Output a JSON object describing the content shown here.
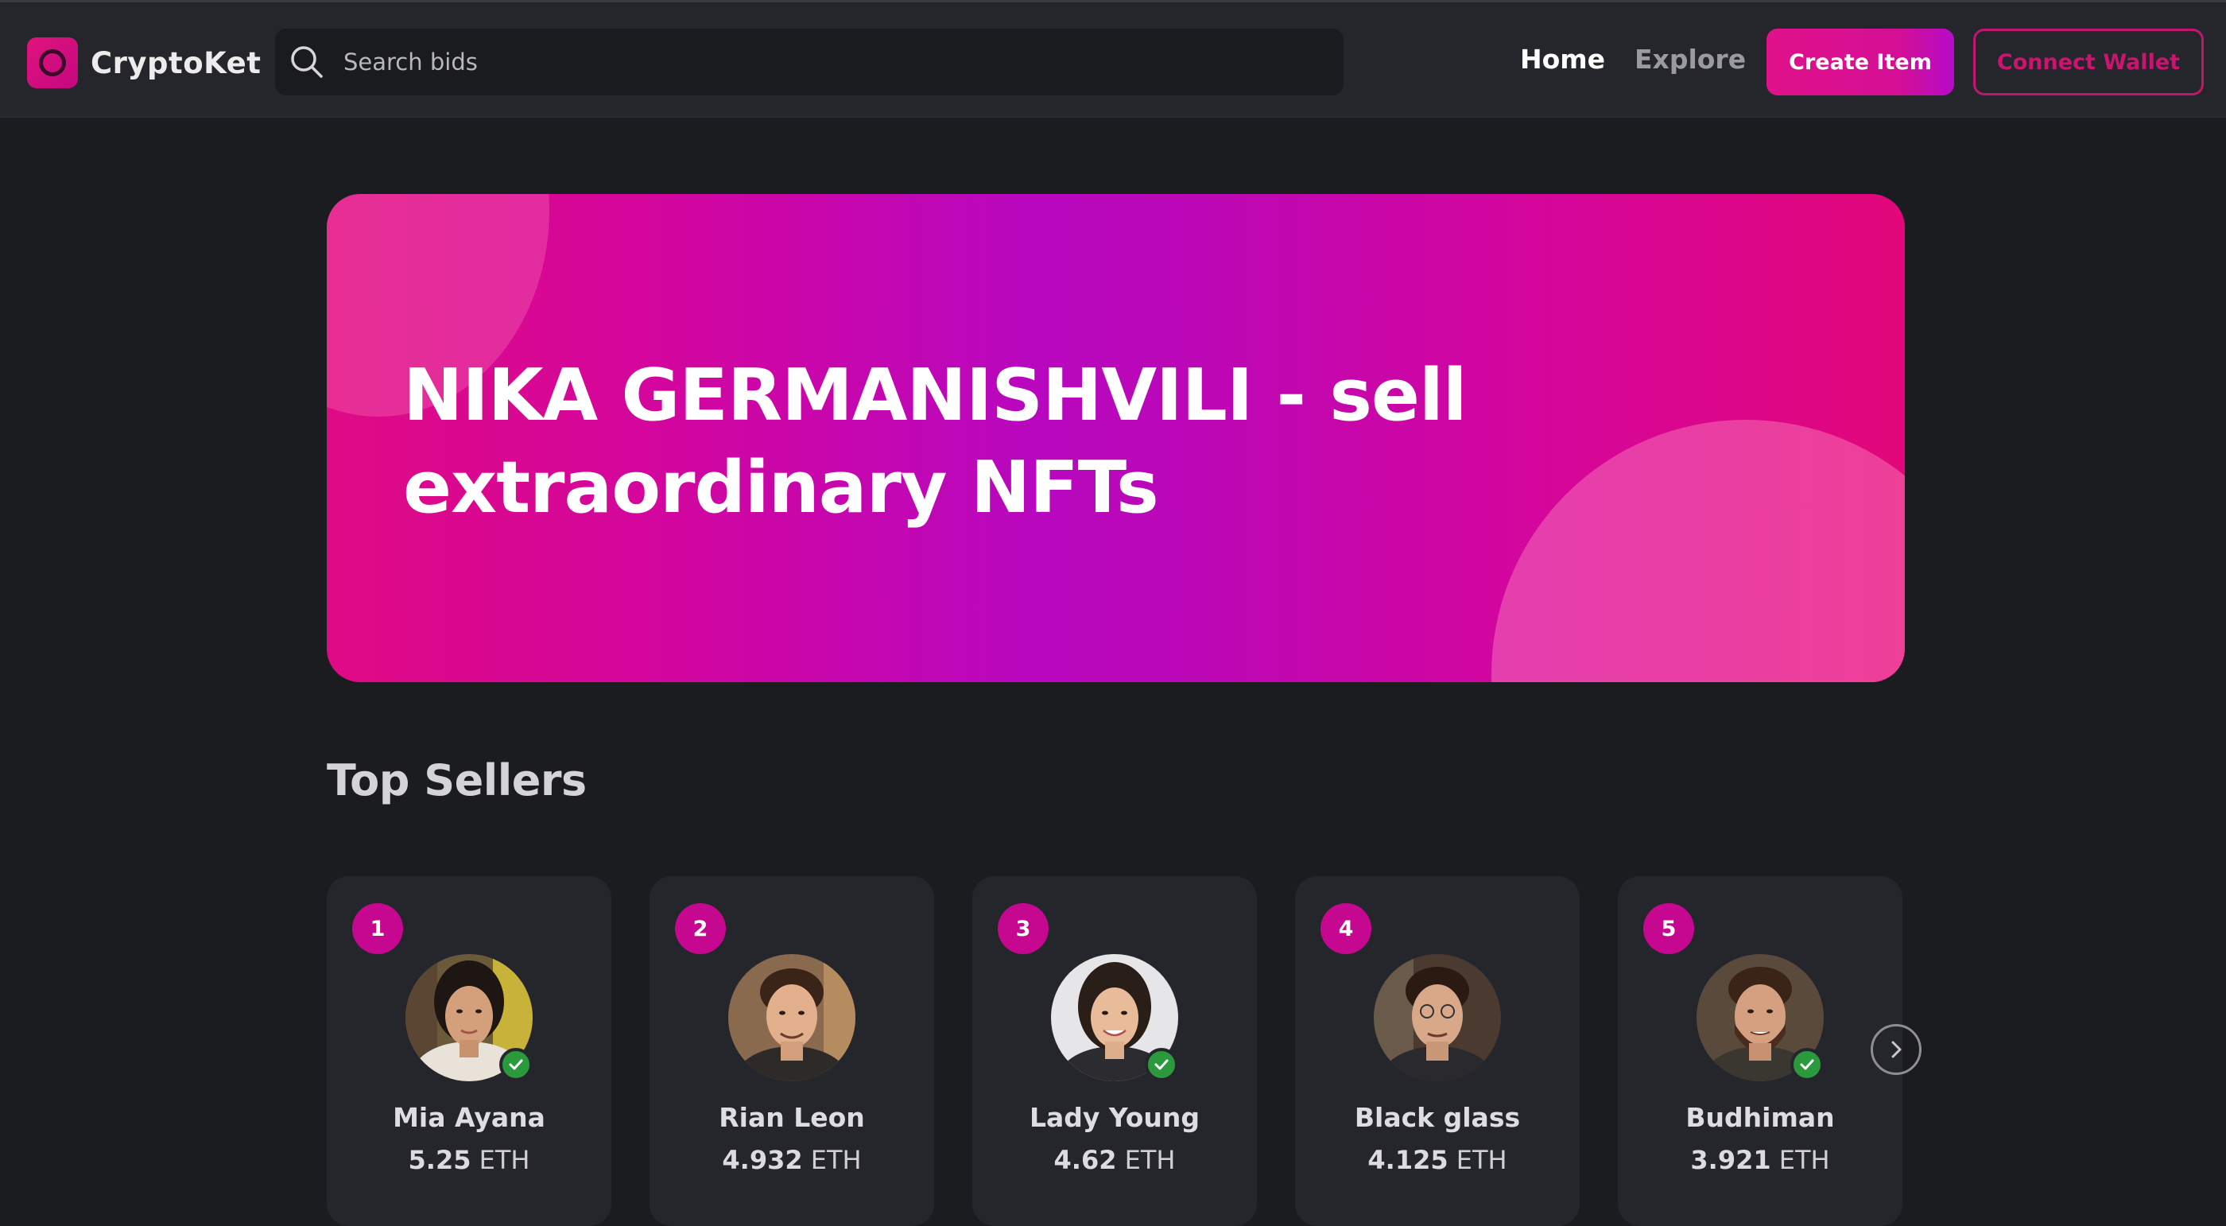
{
  "navbar": {
    "logo_text": "CryptoKet",
    "search_placeholder": "Search bids",
    "links": [
      {
        "label": "Home",
        "active": true
      },
      {
        "label": "Explore",
        "active": false
      }
    ],
    "create_button": "Create Item",
    "connect_button": "Connect Wallet"
  },
  "hero": {
    "line1": "NIKA GERMANISHVILI - sell",
    "line2": "extraordinary NFTs"
  },
  "top_sellers": {
    "title": "Top Sellers",
    "currency": "ETH",
    "sellers": [
      {
        "rank": "1",
        "name": "Mia Ayana",
        "amount": "5.25",
        "verified": true
      },
      {
        "rank": "2",
        "name": "Rian Leon",
        "amount": "4.932",
        "verified": false
      },
      {
        "rank": "3",
        "name": "Lady Young",
        "amount": "4.62",
        "verified": true
      },
      {
        "rank": "4",
        "name": "Black glass",
        "amount": "4.125",
        "verified": false
      },
      {
        "rank": "5",
        "name": "Budhiman",
        "amount": "3.921",
        "verified": true
      }
    ]
  },
  "colors": {
    "accent": "#c5088f",
    "background": "#1b1c20",
    "navbar": "#25262c",
    "verified": "#2a9a3c"
  },
  "icons": {
    "search": "search-icon",
    "verified": "check-icon",
    "next": "chevron-right-icon"
  }
}
